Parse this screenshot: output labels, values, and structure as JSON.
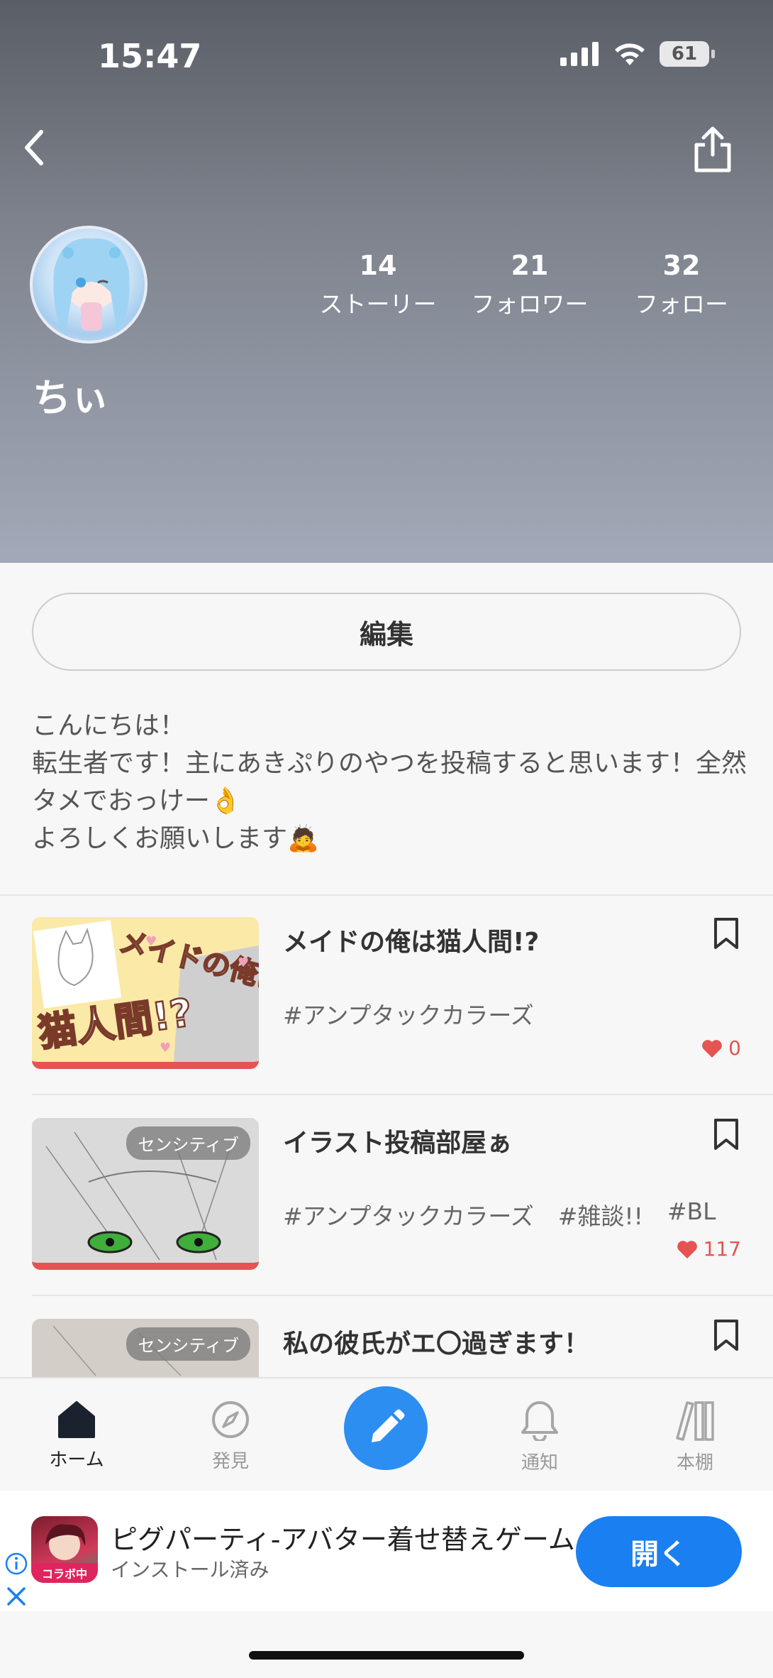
{
  "status_bar": {
    "time": "15:47",
    "battery": "61"
  },
  "profile": {
    "username": "ちぃ",
    "stats": [
      {
        "value": "14",
        "label": "ストーリー"
      },
      {
        "value": "21",
        "label": "フォロワー"
      },
      {
        "value": "32",
        "label": "フォロー"
      }
    ],
    "edit_label": "編集",
    "bio": "こんにちは！\n転生者です！主にあきぷりのやつを投稿すると思います！全然タメでおっけー👌\nよろしくお願いします🙇"
  },
  "stories": [
    {
      "title": "メイドの俺は猫人間!?",
      "thumb_text_1": "メイドの俺は",
      "thumb_text_2": "猫人間!?",
      "tags": [
        "#アンプタックカラーズ"
      ],
      "likes": "0",
      "sensitive": ""
    },
    {
      "title": "イラスト投稿部屋ぁ",
      "tags": [
        "#アンプタックカラーズ",
        "#雑談!!",
        "#BL"
      ],
      "likes": "117",
      "sensitive": "センシティブ"
    },
    {
      "title": "私の彼氏がエ〇過ぎます！",
      "tags": [],
      "likes": "",
      "sensitive": "センシティブ"
    }
  ],
  "tabbar": {
    "items": [
      {
        "label": "ホーム",
        "icon": "home-icon",
        "active": true
      },
      {
        "label": "発見",
        "icon": "compass-icon",
        "active": false
      },
      {
        "label": "通知",
        "icon": "bell-icon",
        "active": false
      },
      {
        "label": "本棚",
        "icon": "bookshelf-icon",
        "active": false
      }
    ],
    "fab_icon": "pencil-icon"
  },
  "ad": {
    "title": "ピグパーティ-アバター着せ替えゲーム",
    "subtitle": "インストール済み",
    "button": "開く",
    "icon_label": "コラボ中"
  },
  "colors": {
    "accent": "#2b8ef0",
    "like": "#e55353",
    "ad_button": "#1a7ff0"
  }
}
